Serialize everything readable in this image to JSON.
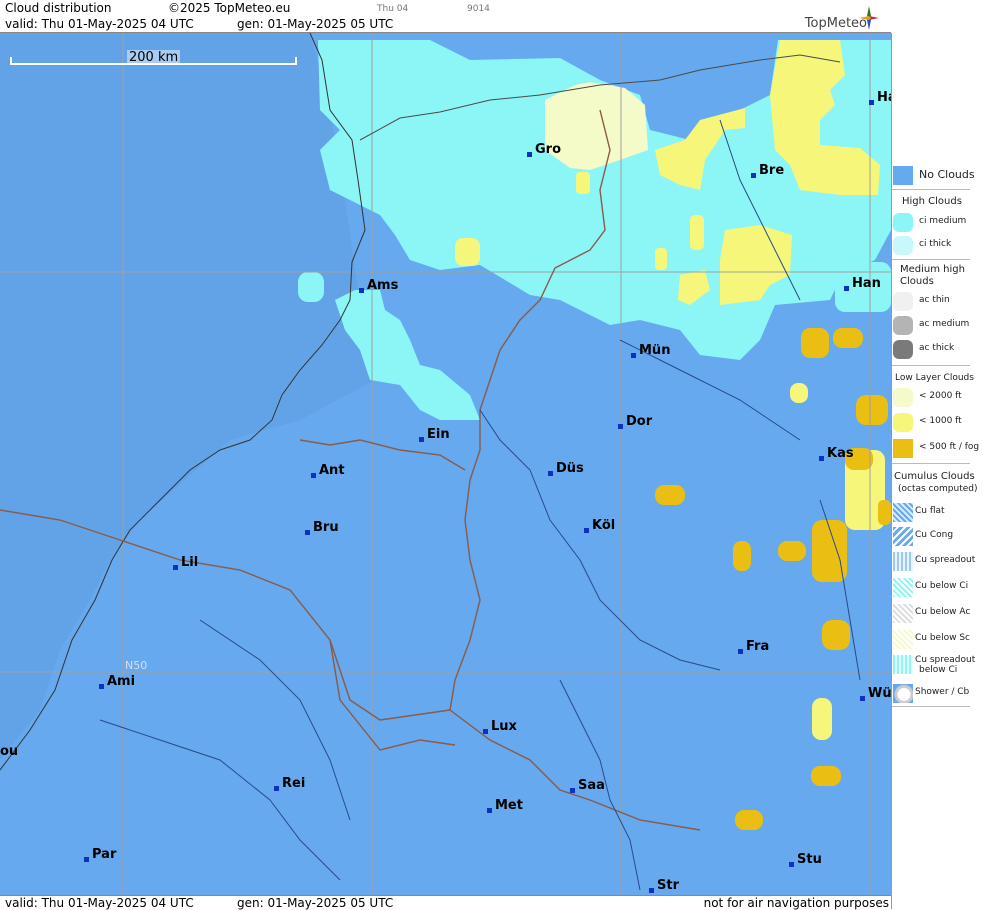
{
  "header": {
    "product": "Cloud distribution",
    "copyright": "©2025 TopMeteo.eu",
    "run_small": "Thu 04",
    "code_small": "9014",
    "valid": "valid:  Thu  01-May-2025  04 UTC",
    "generated": "gen: 01-May-2025 05 UTC",
    "brand": "TopMeteo"
  },
  "footer": {
    "valid": "valid:  Thu  01-May-2025  04 UTC",
    "generated": "gen: 01-May-2025 05 UTC",
    "disclaimer": "not for air navigation purposes"
  },
  "map": {
    "scale_label": "200 km",
    "latitude_label": "N50",
    "colors": {
      "no_clouds": "#66a9ee",
      "ci_medium": "#8cf6f6",
      "low_2000": "#f4fac8",
      "low_1000": "#f6f67a",
      "low_500": "#eabe12",
      "border": "#8a5a4a",
      "river": "#2a4a8a",
      "grid": "#a0a0a0"
    },
    "cities": [
      {
        "name": "Gro"
      },
      {
        "name": "Bre"
      },
      {
        "name": "Ha"
      },
      {
        "name": "Ams"
      },
      {
        "name": "Han"
      },
      {
        "name": "Mün"
      },
      {
        "name": "Ein"
      },
      {
        "name": "Dor"
      },
      {
        "name": "Kas"
      },
      {
        "name": "Ant"
      },
      {
        "name": "Düs"
      },
      {
        "name": "Bru"
      },
      {
        "name": "Köl"
      },
      {
        "name": "Lil"
      },
      {
        "name": "Fra"
      },
      {
        "name": "Ami"
      },
      {
        "name": "Wü"
      },
      {
        "name": "Lux"
      },
      {
        "name": "ou"
      },
      {
        "name": "Rei"
      },
      {
        "name": "Saa"
      },
      {
        "name": "Met"
      },
      {
        "name": "Par"
      },
      {
        "name": "Stu"
      },
      {
        "name": "Str"
      }
    ]
  },
  "legend": {
    "no_clouds": "No Clouds",
    "high_head": "High Clouds",
    "ci_medium": "ci medium",
    "ci_thick": "ci thick",
    "medium_head_1": "Medium high",
    "medium_head_2": "Clouds",
    "ac_thin": "ac thin",
    "ac_medium": "ac medium",
    "ac_thick": "ac thick",
    "low_head": "Low Layer Clouds",
    "low_2000": "< 2000 ft",
    "low_1000": "< 1000 ft",
    "low_500": "< 500 ft / fog",
    "cu_head_1": "Cumulus Clouds",
    "cu_head_2": "(octas computed)",
    "cu_flat": "Cu flat",
    "cu_cong": "Cu Cong",
    "cu_spreadout": "Cu spreadout",
    "cu_below_ci": "Cu below Ci",
    "cu_below_ac": "Cu below Ac",
    "cu_below_sc": "Cu below Sc",
    "cu_spread_ci_1": "Cu spreadout",
    "cu_spread_ci_2": "below Ci",
    "shower": "Shower / Cb"
  }
}
